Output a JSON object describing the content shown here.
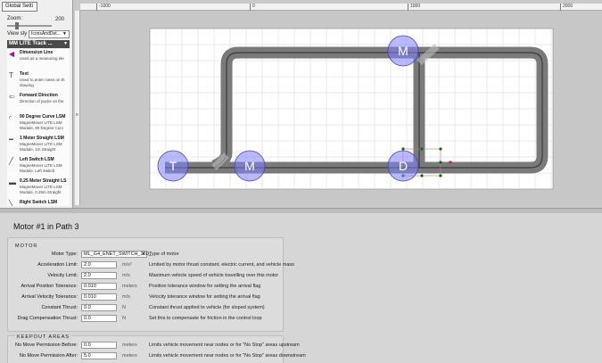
{
  "left_panel": {
    "tab": "Global Setti",
    "zoom_label": "Zoom:",
    "zoom_value": "200",
    "zoom_slider_fraction": 0.2,
    "view_label": "View sty",
    "view_value": "IconsAndDet...",
    "library_title": "MM LITE Track ...",
    "items": [
      {
        "name": "Dimension Line",
        "desc1": "Used as a measuring ele",
        "desc2": "",
        "icon": "dimension-arrow-icon"
      },
      {
        "name": "Text",
        "desc1": "Used to enter notes on th",
        "desc2": "drawing",
        "icon": "text-icon"
      },
      {
        "name": "Forward Direction",
        "desc1": "Direction of pucks on the",
        "desc2": "",
        "icon": "forward-arrow-icon"
      },
      {
        "name": "90 Degree Curve LSM",
        "desc1": "MagneMover LITE LSM",
        "desc2": "Module, 90 Degree Curv",
        "icon": "curve-icon"
      },
      {
        "name": "1 Meter Straight LSM",
        "desc1": "MagneMover LITE LSM",
        "desc2": "Module, 1m Straight",
        "icon": "straight-icon"
      },
      {
        "name": "Left Switch LSM",
        "desc1": "MagneMover LITE LSM",
        "desc2": "Module, Left Switch",
        "icon": "left-switch-icon"
      },
      {
        "name": "0.25 Meter Straight LS",
        "desc1": "MagneMover LITE LSM",
        "desc2": "Module, 0.25m Straight",
        "icon": "short-straight-icon"
      },
      {
        "name": "Right Switch LSM",
        "desc1": "",
        "desc2": "",
        "icon": "right-switch-icon"
      }
    ]
  },
  "ruler": {
    "top_ticks": [
      "-1000",
      "0",
      "1000",
      "2000"
    ],
    "left_ticks": [
      "0"
    ]
  },
  "canvas": {
    "motor_labels": [
      "M",
      "M",
      "D"
    ],
    "terminus_label": "T"
  },
  "properties": {
    "title": "Motor  #1  in Path  3",
    "motor_section": "MOTOR",
    "keepout_section": "KEEPOUT AREAS",
    "motor_rows": [
      {
        "label": "Motor Type:",
        "value": "ML_G4_ENET_SWITCH_250_",
        "unit": "",
        "desc": "Type of motor",
        "dropdown": true
      },
      {
        "label": "Acceleration Limit:",
        "value": "2.0",
        "unit": "m/s²",
        "desc": "Limited by motor thrust constant, electric current, and vehicle mass"
      },
      {
        "label": "Velocity Limit:",
        "value": "2.0",
        "unit": "m/s",
        "desc": "Maximum vehicle speed of vehicle travelling over this motor"
      },
      {
        "label": "Arrival Position Tolerance:",
        "value": "0.010",
        "unit": "meters",
        "desc": "Position tolerance window for setting the arrival flag"
      },
      {
        "label": "Arrival Velocity Tolerance:",
        "value": "0.010",
        "unit": "m/s",
        "desc": "Velocity tolerance window for setting the arrival flag"
      },
      {
        "label": "Constant Thrust:",
        "value": "0.0",
        "unit": "N",
        "desc": "Constant thrust applied to vehicle (for sloped system)"
      },
      {
        "label": "Drag Compensation Thrust:",
        "value": "0.0",
        "unit": "N",
        "desc": "Set this to compensate for friction in the control loop"
      }
    ],
    "keepout_rows": [
      {
        "label": "No Move Permission Before:",
        "value": "0.0",
        "unit": "meters",
        "desc": "Limits vehicle movement near nodes or for \"No Stop\" areas upstream"
      },
      {
        "label": "No Move Permission After:",
        "value": "5.0",
        "unit": "meters",
        "desc": "Limits vehicle movement near nodes or for \"No Stop\" areas downstream"
      }
    ]
  },
  "colors": {
    "track": "#7a7a7a",
    "rail_line": "#3b3b3b",
    "node_fill": "#8080ff",
    "grid": "#d6d6d6"
  }
}
